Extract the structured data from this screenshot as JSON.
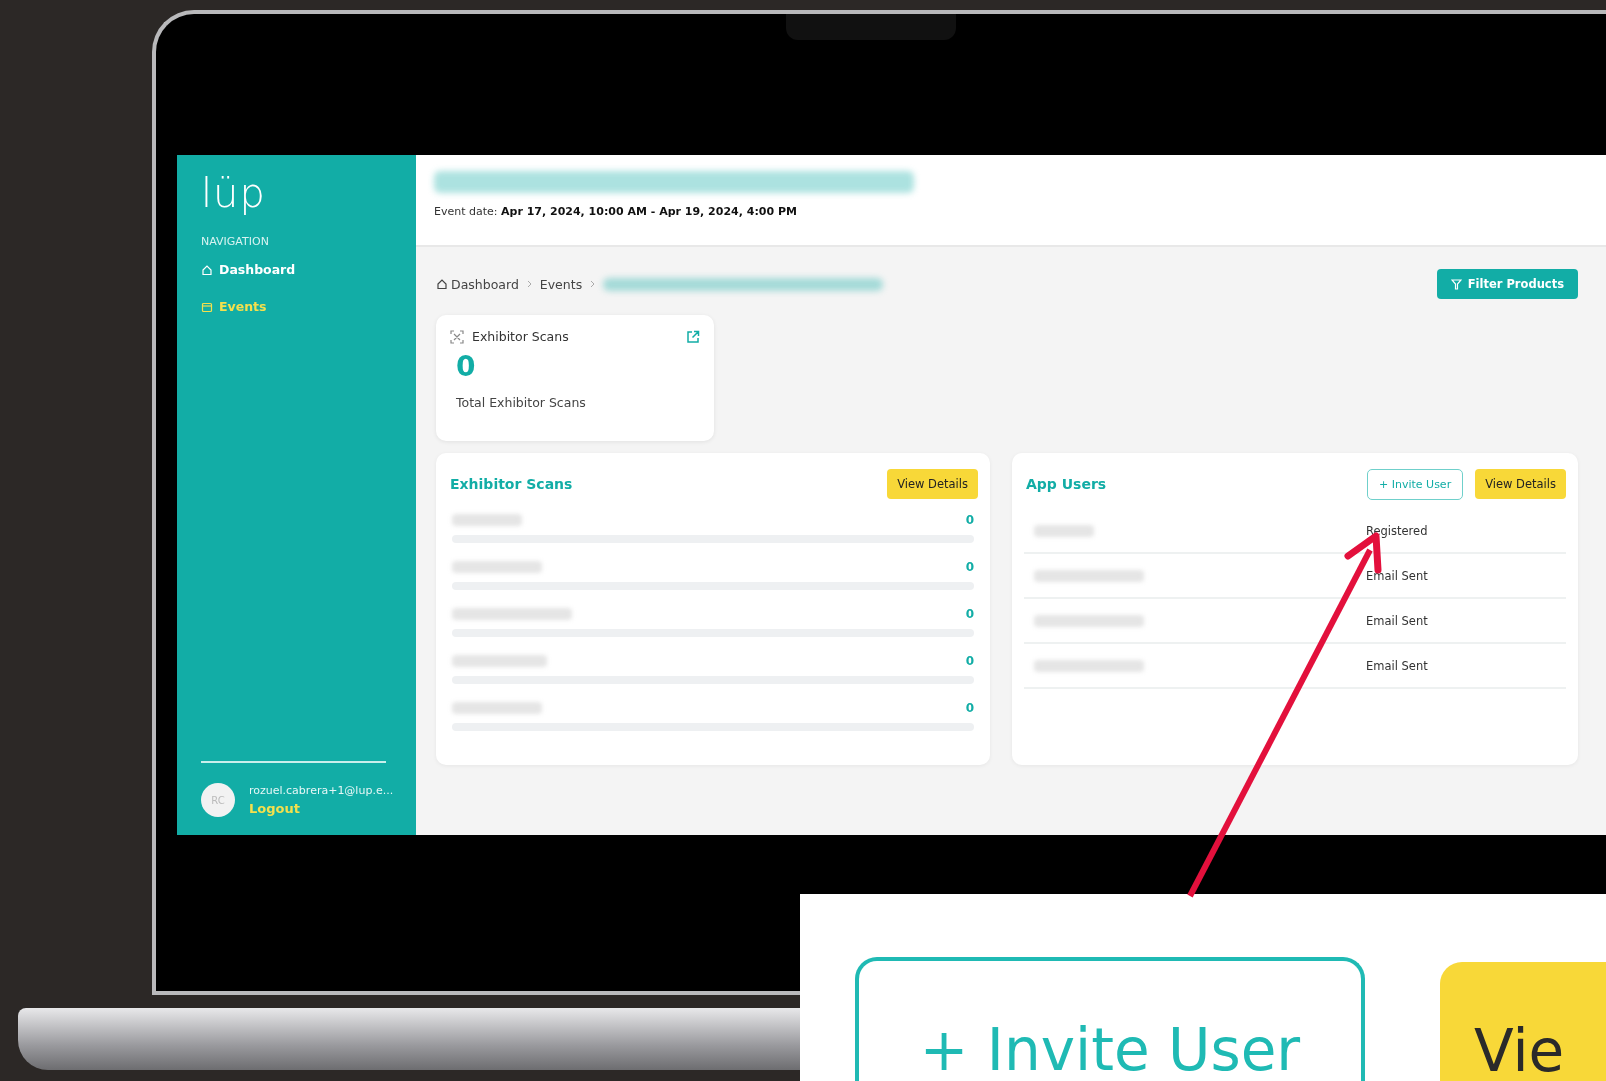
{
  "sidebar": {
    "logo": "lüp",
    "section_label": "NAVIGATION",
    "items": [
      {
        "label": "Dashboard",
        "selected": false
      },
      {
        "label": "Events",
        "selected": true
      }
    ],
    "user": {
      "initials": "RC",
      "email": "rozuel.cabrera+1@lup.e...",
      "logout": "Logout"
    }
  },
  "header": {
    "event_date_label": "Event date:",
    "event_date": "Apr 17, 2024, 10:00 AM - Apr 19, 2024, 4:00 PM"
  },
  "breadcrumb": [
    "Dashboard",
    "Events"
  ],
  "filter_button": "Filter Products",
  "stat_card": {
    "title": "Exhibitor Scans",
    "value": "0",
    "caption": "Total Exhibitor Scans"
  },
  "exhibitor_panel": {
    "title": "Exhibitor Scans",
    "button": "View Details",
    "rows": [
      {
        "count": "0",
        "level": 0
      },
      {
        "count": "0",
        "level": 0
      },
      {
        "count": "0",
        "level": 0
      },
      {
        "count": "0",
        "level": 0
      },
      {
        "count": "0",
        "level": 0
      }
    ]
  },
  "users_panel": {
    "title": "App Users",
    "invite_button": "+ Invite User",
    "button": "View Details",
    "rows": [
      {
        "status": "Registered"
      },
      {
        "status": "Email Sent"
      },
      {
        "status": "Email Sent"
      },
      {
        "status": "Email Sent"
      }
    ]
  },
  "callout": {
    "invite_button": "+ Invite User",
    "view_button": "Vie"
  }
}
